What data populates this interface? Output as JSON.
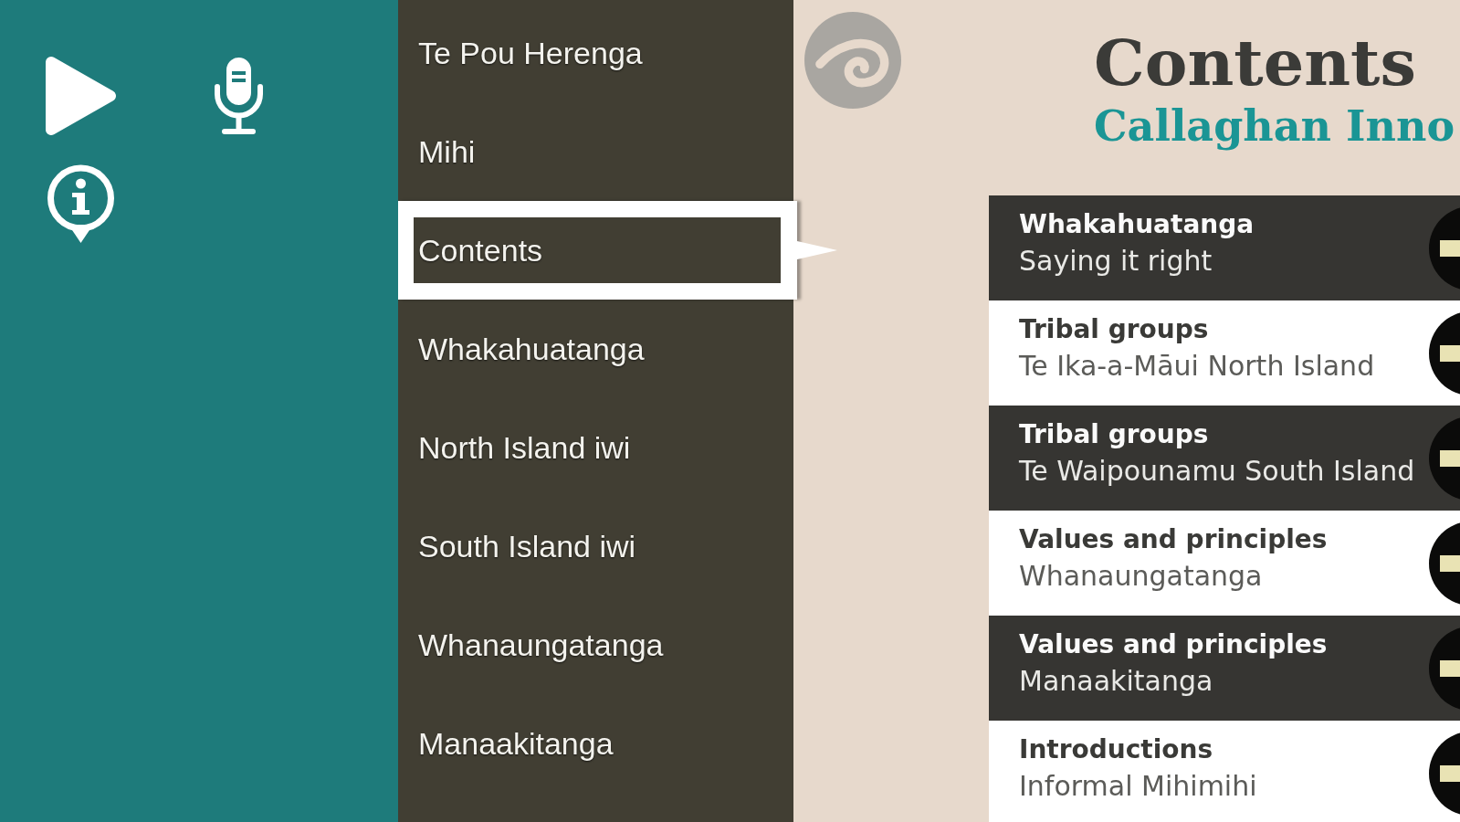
{
  "menu": {
    "items": [
      {
        "label": "Te Pou Herenga",
        "selected": false
      },
      {
        "label": "Mihi",
        "selected": false
      },
      {
        "label": "Contents",
        "selected": true
      },
      {
        "label": "Whakahuatanga",
        "selected": false
      },
      {
        "label": "North Island iwi",
        "selected": false
      },
      {
        "label": "South Island iwi",
        "selected": false
      },
      {
        "label": "Whanaungatanga",
        "selected": false
      },
      {
        "label": "Manaakitanga",
        "selected": false
      }
    ]
  },
  "page": {
    "title": "Contents",
    "subtitle": "Callaghan Inno",
    "sections": [
      {
        "title": "Whakahuatanga",
        "subtitle": "Saying it right"
      },
      {
        "title": "Tribal groups",
        "subtitle": "Te Ika-a-Māui North Island"
      },
      {
        "title": "Tribal groups",
        "subtitle": "Te Waipounamu South Island"
      },
      {
        "title": "Values and principles",
        "subtitle": "Whanaungatanga"
      },
      {
        "title": "Values and principles",
        "subtitle": "Manaakitanga"
      },
      {
        "title": "Introductions",
        "subtitle": "Informal Mihimihi"
      }
    ]
  }
}
